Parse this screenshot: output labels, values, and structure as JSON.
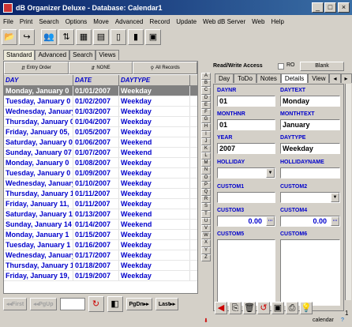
{
  "window": {
    "title": "dB Organizer Deluxe - Database: Calendar1",
    "min": "_",
    "max": "□",
    "close": "×"
  },
  "menu": [
    "File",
    "Print",
    "Search",
    "Options",
    "Move",
    "Advanced",
    "Record",
    "Update",
    "Web dB Server",
    "Web",
    "Help"
  ],
  "toolbar_icons": [
    "folder-open-icon",
    "export-icon",
    "users-icon",
    "sort-icon",
    "table-icon",
    "grid-icon",
    "page-icon",
    "report-icon",
    "calculator-icon"
  ],
  "left_tabs": [
    "Standard",
    "Advanced",
    "Search",
    "Views"
  ],
  "sort_buttons": {
    "entry": "Entry Order",
    "none": "NONE",
    "all": "All Records"
  },
  "grid": {
    "headers": [
      "DAY",
      "DATE",
      "DAYTYPE"
    ],
    "rows": [
      [
        "Monday, January 0",
        "01/01/2007",
        "Weekday"
      ],
      [
        "Tuesday, January 0",
        "01/02/2007",
        "Weekday"
      ],
      [
        "Wednesday, January",
        "01/03/2007",
        "Weekday"
      ],
      [
        "Thursday, January 0",
        "01/04/2007",
        "Weekday"
      ],
      [
        "Friday, January 05,",
        "01/05/2007",
        "Weekday"
      ],
      [
        "Saturday, January 0",
        "01/06/2007",
        "Weekend"
      ],
      [
        "Sunday, January 07",
        "01/07/2007",
        "Weekend"
      ],
      [
        "Monday, January 0",
        "01/08/2007",
        "Weekday"
      ],
      [
        "Tuesday, January 0",
        "01/09/2007",
        "Weekday"
      ],
      [
        "Wednesday, January",
        "01/10/2007",
        "Weekday"
      ],
      [
        "Thursday, January 1",
        "01/11/2007",
        "Weekday"
      ],
      [
        "Friday, January 11,",
        "01/11/2007",
        "Weekday"
      ],
      [
        "Saturday, January 1",
        "01/13/2007",
        "Weekend"
      ],
      [
        "Sunday, January 14",
        "01/14/2007",
        "Weekend"
      ],
      [
        "Monday, January 1",
        "01/15/2007",
        "Weekday"
      ],
      [
        "Tuesday, January 1",
        "01/16/2007",
        "Weekday"
      ],
      [
        "Wednesday, January",
        "01/17/2007",
        "Weekday"
      ],
      [
        "Thursday, January 1",
        "01/18/2007",
        "Weekday"
      ],
      [
        "Friday, January 19,",
        "01/19/2007",
        "Weekday"
      ]
    ]
  },
  "nav": {
    "first": "First",
    "pgup": "PgUp",
    "pgdn": "PgDn",
    "last": "Last"
  },
  "access": {
    "label": "Read/Write Access",
    "ro": "RO",
    "blank": "Blank"
  },
  "right_tabs": [
    "Day",
    "ToDo",
    "Notes",
    "Details",
    "View"
  ],
  "alpha": [
    "A",
    "B",
    "C",
    "D",
    "E",
    "F",
    "G",
    "H",
    "I",
    "J",
    "K",
    "L",
    "M",
    "N",
    "O",
    "P",
    "Q",
    "R",
    "S",
    "T",
    "U",
    "V",
    "W",
    "X",
    "Y",
    "Z"
  ],
  "fields": {
    "daynr": {
      "label": "DAYNR",
      "value": "01"
    },
    "daytext": {
      "label": "DAYTEXT",
      "value": "Monday"
    },
    "monthnr": {
      "label": "MONTHNR",
      "value": "01"
    },
    "monthtext": {
      "label": "MONTHTEXT",
      "value": "January"
    },
    "year": {
      "label": "YEAR",
      "value": "2007"
    },
    "daytype": {
      "label": "DAYTYPE",
      "value": "Weekday"
    },
    "holiday": {
      "label": "HOLLIDAY",
      "value": ""
    },
    "holidayname": {
      "label": "HOLLIDAYNAME",
      "value": ""
    },
    "custom1": {
      "label": "CUSTOM1",
      "value": ""
    },
    "custom2": {
      "label": "CUSTOM2",
      "value": ""
    },
    "custom3": {
      "label": "CUSTOM3",
      "value": "0.00"
    },
    "custom4": {
      "label": "CUSTOM4",
      "value": "0.00"
    },
    "custom5": {
      "label": "CUSTOM5",
      "value": ""
    },
    "custom6": {
      "label": "CUSTOM6",
      "value": ""
    }
  },
  "page_indicator": "1",
  "status": {
    "db": "calendar"
  }
}
